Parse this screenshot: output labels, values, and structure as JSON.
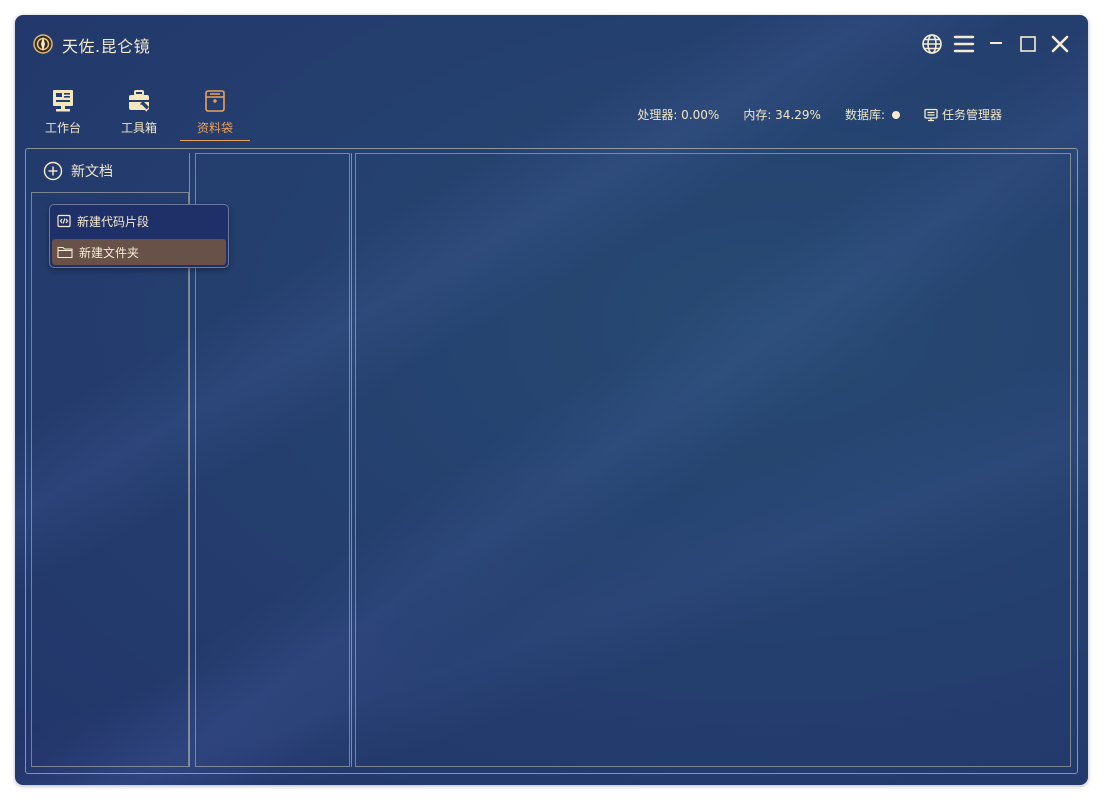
{
  "window": {
    "title": "天佐.昆仑镜",
    "controls": [
      "globe-icon",
      "menu-icon",
      "minimize-icon",
      "maximize-icon",
      "close-icon"
    ]
  },
  "toolbar": {
    "items": [
      {
        "label": "工作台",
        "icon": "workbench-icon",
        "active": false
      },
      {
        "label": "工具箱",
        "icon": "toolbox-icon",
        "active": false
      },
      {
        "label": "资料袋",
        "icon": "archive-bag-icon",
        "active": true
      }
    ]
  },
  "status": {
    "cpu": "处理器: 0.00%",
    "memory": "内存: 34.29%",
    "database_label": "数据库:",
    "task_manager": "任务管理器"
  },
  "sidebar": {
    "new_doc_label": "新文档"
  },
  "context_menu": {
    "items": [
      {
        "label": "新建代码片段",
        "icon": "code-snippet-icon",
        "highlighted": false
      },
      {
        "label": "新建文件夹",
        "icon": "folder-icon",
        "highlighted": true
      }
    ]
  },
  "colors": {
    "background": "#243e6e",
    "text": "#f0e6c8",
    "accent": "#e9a15a",
    "menu_highlight": "#685149"
  }
}
